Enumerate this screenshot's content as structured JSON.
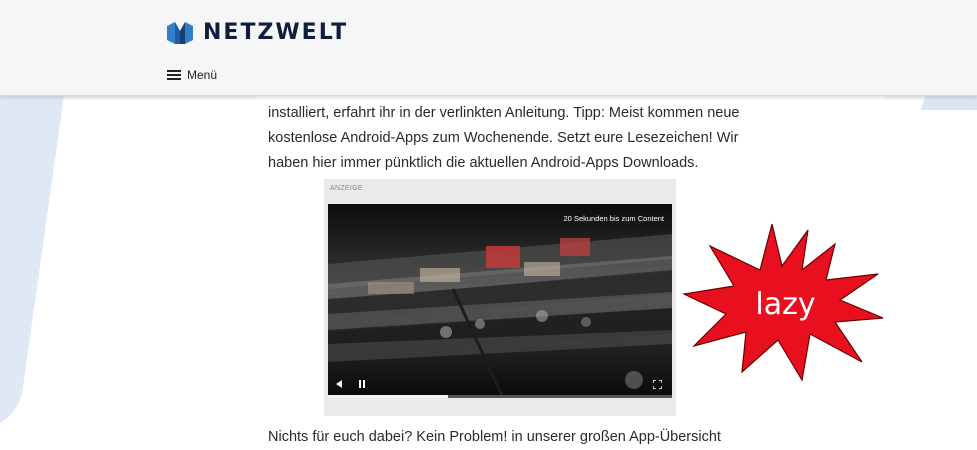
{
  "brand": {
    "name": "NETZWELT",
    "logo_icon": "netzwelt-logo-icon"
  },
  "nav": {
    "menu_label": "Menü",
    "menu_icon": "hamburger-icon"
  },
  "article": {
    "lines_top": [
      "installiert, erfahrt ihr in der verlinkten Anleitung. Tipp: Meist kommen neue",
      "kostenlose Android-Apps zum Wochenende. Setzt eure Lesezeichen! Wir",
      "haben hier immer pünktlich die aktuellen Android-Apps Downloads."
    ],
    "line_bottom": "Nichts für euch dabei? Kein Problem! in unserer großen App-Übersicht"
  },
  "ad": {
    "label": "ANZEIGE",
    "skip_text": "20 Sekunden bis zum Content",
    "progress": 0.35,
    "controls": [
      "play-back-icon",
      "pause-icon",
      "fullscreen-icon"
    ]
  },
  "badge": {
    "text": "lazy",
    "color": "#e8101e"
  },
  "colors": {
    "brand_dark": "#0e1e3c",
    "brand_blue": "#2f80c8",
    "header_bg": "#f6f6f6"
  }
}
